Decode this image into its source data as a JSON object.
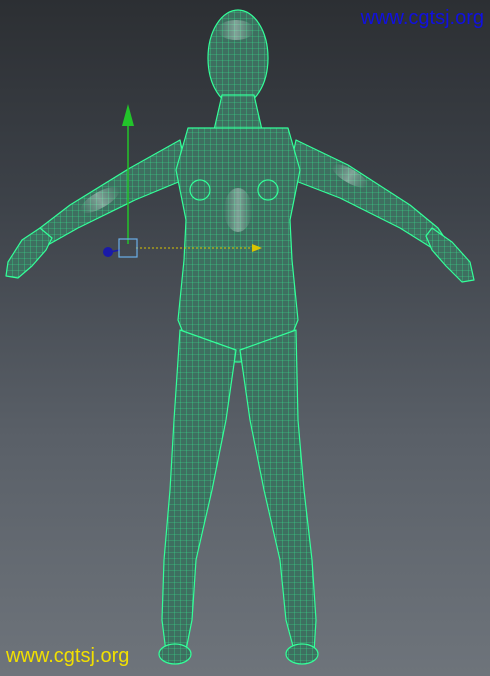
{
  "viewport": {
    "watermark_top": "www.cgtsj.org",
    "watermark_bottom": "www.cgtsj.org"
  },
  "colors": {
    "watermark_top": "#1010e0",
    "watermark_bottom": "#f2e000",
    "wireframe": "#33ff99",
    "mesh_fill": "#3e6f60",
    "manipulator_axis_y": "#22c42a",
    "manipulator_axis_x": "#d9c400",
    "manipulator_handle": "#1a1aa8",
    "manipulator_box": "#6aaee8"
  },
  "icons": {
    "model": "wireframe-human-model",
    "manipulator": "move-manipulator-icon"
  }
}
